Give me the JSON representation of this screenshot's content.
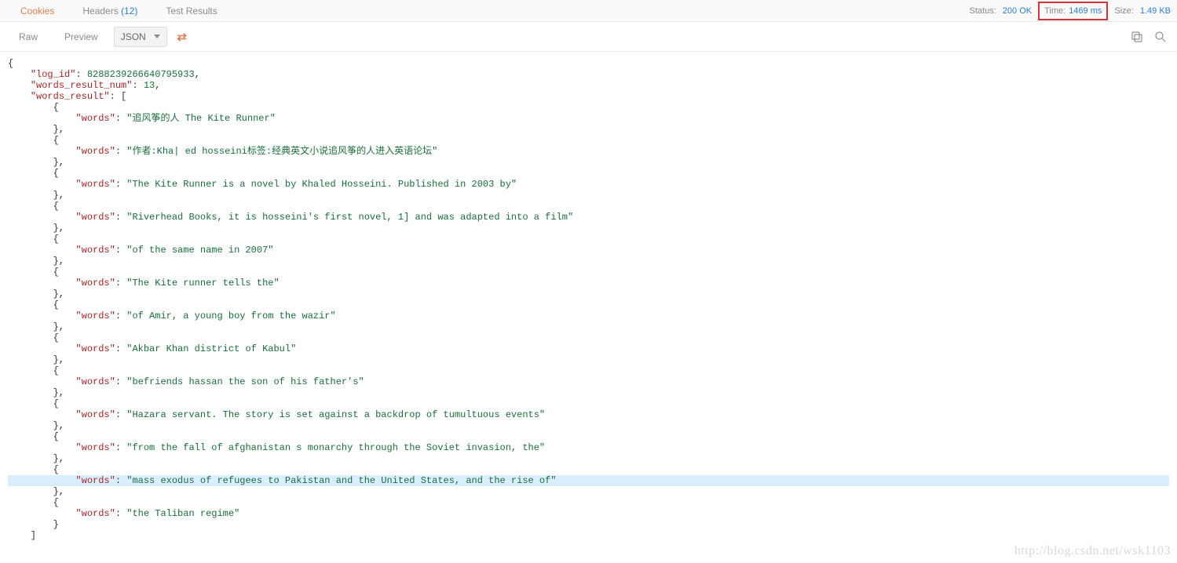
{
  "tabs": {
    "cookies": "Cookies",
    "headers": "Headers",
    "headers_count": "(12)",
    "test_results": "Test Results"
  },
  "status": {
    "status_label": "Status:",
    "status_value": "200 OK",
    "time_label": "Time:",
    "time_value": "1469 ms",
    "size_label": "Size:",
    "size_value": "1.49 KB"
  },
  "toolbar": {
    "raw": "Raw",
    "preview": "Preview",
    "json": "JSON"
  },
  "json": {
    "log_id_key": "\"log_id\"",
    "log_id_val": "8288239266640795933",
    "wrn_key": "\"words_result_num\"",
    "wrn_val": "13",
    "wr_key": "\"words_result\"",
    "words_key": "\"words\"",
    "items": [
      "\"追风筝的人 The Kite Runner\"",
      "\"作者:Kha| ed hosseini标签:经典英文小说追风筝的人进入英语论坛\"",
      "\"The Kite Runner is a novel by Khaled Hosseini. Published in 2003 by\"",
      "\"Riverhead Books, it is hosseini's first novel, 1] and was adapted into a film\"",
      "\"of the same name in 2007\"",
      "\"The Kite runner tells the\"",
      "\"of Amir, a young boy from the wazir\"",
      "\"Akbar Khan district of Kabul\"",
      "\"befriends hassan the son of his father's\"",
      "\"Hazara servant. The story is set against a backdrop of tumultuous events\"",
      "\"from the fall of afghanistan s monarchy through the Soviet invasion, the\"",
      "\"mass exodus of refugees to Pakistan and the United States, and the rise of\"",
      "\"the Taliban regime\""
    ],
    "highlight_index": 11
  },
  "watermark": "http://blog.csdn.net/wsk1103"
}
